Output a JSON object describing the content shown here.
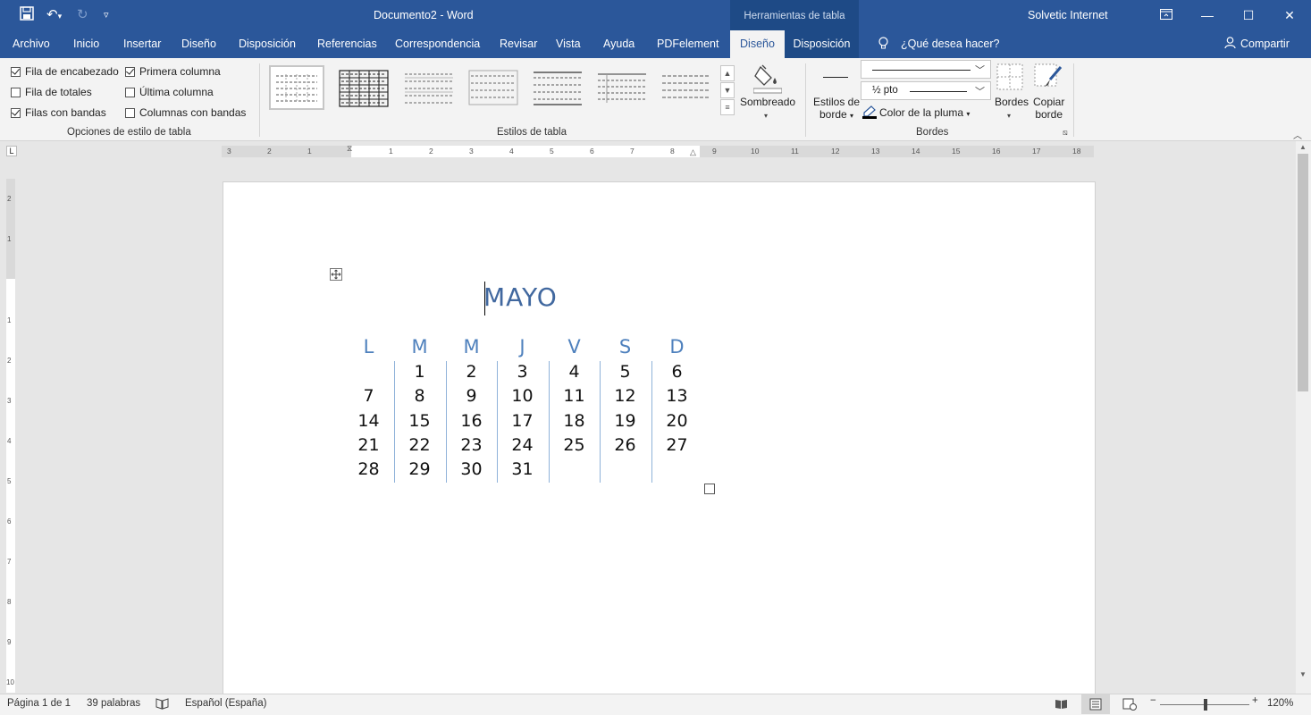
{
  "window": {
    "title": "Documento2 - Word",
    "context_header": "Herramientas de tabla",
    "user": "Solvetic Internet"
  },
  "tabs": [
    {
      "label": "Archivo"
    },
    {
      "label": "Inicio"
    },
    {
      "label": "Insertar"
    },
    {
      "label": "Diseño"
    },
    {
      "label": "Disposición"
    },
    {
      "label": "Referencias"
    },
    {
      "label": "Correspondencia"
    },
    {
      "label": "Revisar"
    },
    {
      "label": "Vista"
    },
    {
      "label": "Ayuda"
    },
    {
      "label": "PDFelement"
    },
    {
      "label": "Diseño"
    },
    {
      "label": "Disposición"
    }
  ],
  "tell_me": "¿Qué desea hacer?",
  "share": "Compartir",
  "ribbon": {
    "options": {
      "header_row": {
        "label": "Fila de encabezado",
        "checked": true
      },
      "first_column": {
        "label": "Primera columna",
        "checked": true
      },
      "total_row": {
        "label": "Fila de totales",
        "checked": false
      },
      "last_column": {
        "label": "Última columna",
        "checked": false
      },
      "banded_rows": {
        "label": "Filas con bandas",
        "checked": true
      },
      "banded_columns": {
        "label": "Columnas con bandas",
        "checked": false
      },
      "group_label": "Opciones de estilo de tabla"
    },
    "styles": {
      "group_label": "Estilos de tabla"
    },
    "shading": {
      "label": "Sombreado"
    },
    "borders": {
      "border_styles_l1": "Estilos de",
      "border_styles_l2": "borde",
      "pen_weight": "½ pto",
      "pen_color": "Color de la pluma",
      "borders_btn": "Bordes",
      "copy_l1": "Copiar",
      "copy_l2": "borde",
      "group_label": "Bordes"
    }
  },
  "document": {
    "title": "MAYO",
    "days": [
      "L",
      "M",
      "M",
      "J",
      "V",
      "S",
      "D"
    ],
    "weeks": [
      [
        "",
        "1",
        "2",
        "3",
        "4",
        "5",
        "6"
      ],
      [
        "7",
        "8",
        "9",
        "10",
        "11",
        "12",
        "13"
      ],
      [
        "14",
        "15",
        "16",
        "17",
        "18",
        "19",
        "20"
      ],
      [
        "21",
        "22",
        "23",
        "24",
        "25",
        "26",
        "27"
      ],
      [
        "28",
        "29",
        "30",
        "31",
        "",
        "",
        ""
      ]
    ]
  },
  "status": {
    "page": "Página 1 de 1",
    "words": "39 palabras",
    "language": "Español (España)",
    "zoom": "120%"
  },
  "ruler": {
    "h_numbers": [
      "3",
      "2",
      "1",
      "1",
      "2",
      "3",
      "4",
      "5",
      "6",
      "7",
      "8",
      "9",
      "10",
      "11",
      "12",
      "13",
      "14",
      "15",
      "16",
      "17",
      "18"
    ],
    "v_numbers": [
      "2",
      "1",
      "1",
      "2",
      "3",
      "4",
      "5",
      "6",
      "7",
      "8",
      "9",
      "10"
    ]
  },
  "colors": {
    "accent": "#2b579a",
    "heading": "#41689f",
    "day_header": "#4f81bd"
  }
}
